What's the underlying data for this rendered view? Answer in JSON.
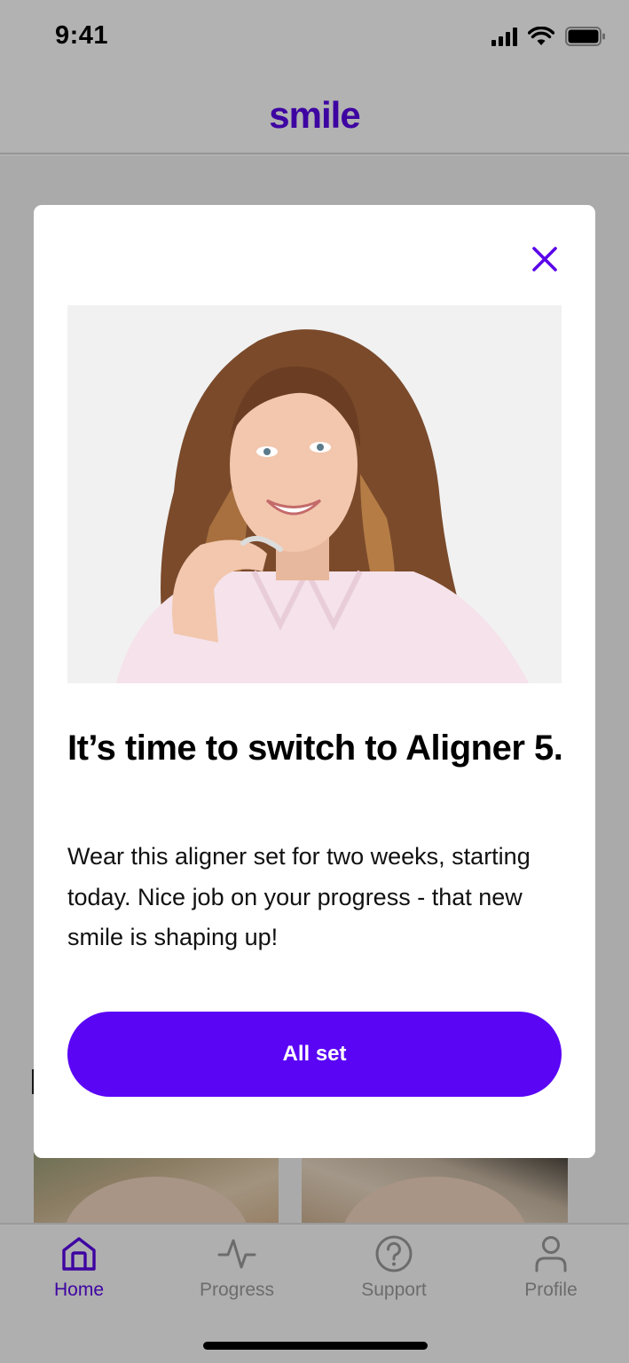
{
  "status_bar": {
    "time": "9:41",
    "icons": [
      "cellular-signal-icon",
      "wifi-icon",
      "battery-icon"
    ]
  },
  "header": {
    "logo": "smile"
  },
  "modal": {
    "close_icon": "close-icon",
    "title": "It’s time to switch to Aligner 5.",
    "body": "Wear this aligner set for two weeks, starting today. Nice job on your progress - that new smile is shaping up!",
    "button_label": "All set"
  },
  "tab_bar": {
    "tabs": [
      {
        "label": "Home",
        "icon": "home-icon",
        "active": true
      },
      {
        "label": "Progress",
        "icon": "activity-icon",
        "active": false
      },
      {
        "label": "Support",
        "icon": "help-icon",
        "active": false
      },
      {
        "label": "Profile",
        "icon": "person-icon",
        "active": false
      }
    ]
  },
  "colors": {
    "brand": "#5a06e8",
    "primary_button": "#5a06f5",
    "inactive_tab": "#9b9b9b",
    "overlay": "rgba(0,0,0,0.30)"
  }
}
